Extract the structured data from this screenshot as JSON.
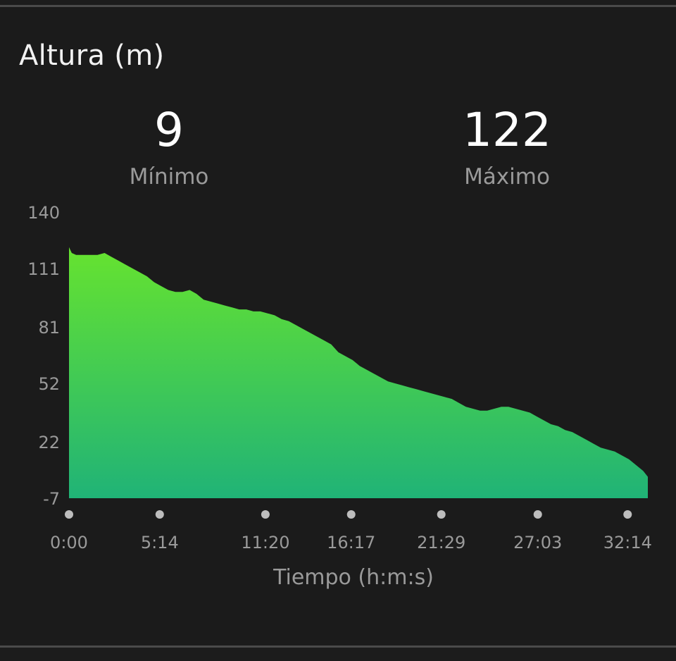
{
  "card": {
    "title": "Altura (m)"
  },
  "stats": {
    "min": {
      "value": "9",
      "label": "Mínimo"
    },
    "max": {
      "value": "122",
      "label": "Máximo"
    }
  },
  "colors": {
    "background": "#1b1b1b",
    "fill_top": "#66e32f",
    "fill_bottom": "#20b377",
    "text_primary": "#ffffff",
    "text_secondary": "#9a9a9a",
    "tick_dot": "#bdbdbd"
  },
  "chart_data": {
    "type": "area",
    "title": "Altura (m)",
    "xlabel": "Tiempo (h:m:s)",
    "ylabel": "",
    "y_ticks": [
      "140",
      "111",
      "81",
      "52",
      "22",
      "-7"
    ],
    "y_tick_values": [
      140,
      111,
      81,
      52,
      22,
      -7
    ],
    "ylim": [
      -7,
      140
    ],
    "x_tick_labels": [
      "0:00",
      "5:14",
      "11:20",
      "16:17",
      "21:29",
      "27:03",
      "32:14"
    ],
    "x_tick_minutes": [
      0,
      5.233,
      11.333,
      16.283,
      21.483,
      27.05,
      32.233
    ],
    "xlim_minutes": [
      0,
      33.4
    ],
    "grid": false,
    "legend": "none",
    "series": [
      {
        "x": [
          0,
          0.16,
          0.41,
          0.82,
          1.23,
          1.64,
          2.05,
          2.45,
          2.86,
          3.27,
          3.68,
          4.09,
          4.5,
          4.91,
          5.32,
          5.73,
          6.14,
          6.55,
          6.96,
          7.36,
          7.77,
          8.18,
          8.59,
          9.0,
          9.41,
          9.82,
          10.23,
          10.64,
          11.04,
          11.45,
          11.86,
          12.27,
          12.68,
          13.09,
          13.5,
          13.91,
          14.32,
          14.73,
          15.13,
          15.54,
          15.95,
          16.36,
          16.77,
          17.18,
          17.59,
          18.0,
          18.41,
          18.81,
          19.22,
          19.63,
          20.04,
          20.45,
          20.86,
          21.27,
          21.68,
          22.09,
          22.5,
          22.9,
          23.31,
          23.72,
          24.13,
          24.54,
          24.95,
          25.36,
          25.77,
          26.18,
          26.59,
          26.99,
          27.4,
          27.81,
          28.22,
          28.63,
          29.04,
          29.45,
          29.86,
          30.27,
          30.68,
          31.09,
          31.49,
          31.9,
          32.31,
          32.72,
          33.13,
          33.4
        ],
        "y": [
          122,
          119,
          118,
          118,
          118,
          118,
          119,
          117,
          115,
          113,
          111,
          109,
          107,
          104,
          102,
          100,
          99,
          99,
          100,
          98,
          95,
          94,
          93,
          92,
          91,
          90,
          90,
          89,
          89,
          88,
          87,
          85,
          84,
          82,
          80,
          78,
          76,
          74,
          72,
          68,
          66,
          64,
          61,
          59,
          57,
          55,
          53,
          52,
          51,
          50,
          49,
          48,
          47,
          46,
          45,
          44,
          42,
          40,
          39,
          38,
          38,
          39,
          40,
          40,
          39,
          38,
          37,
          35,
          33,
          31,
          30,
          28,
          27,
          25,
          23,
          21,
          19,
          18,
          17,
          15,
          13,
          10,
          7,
          4
        ]
      }
    ]
  }
}
